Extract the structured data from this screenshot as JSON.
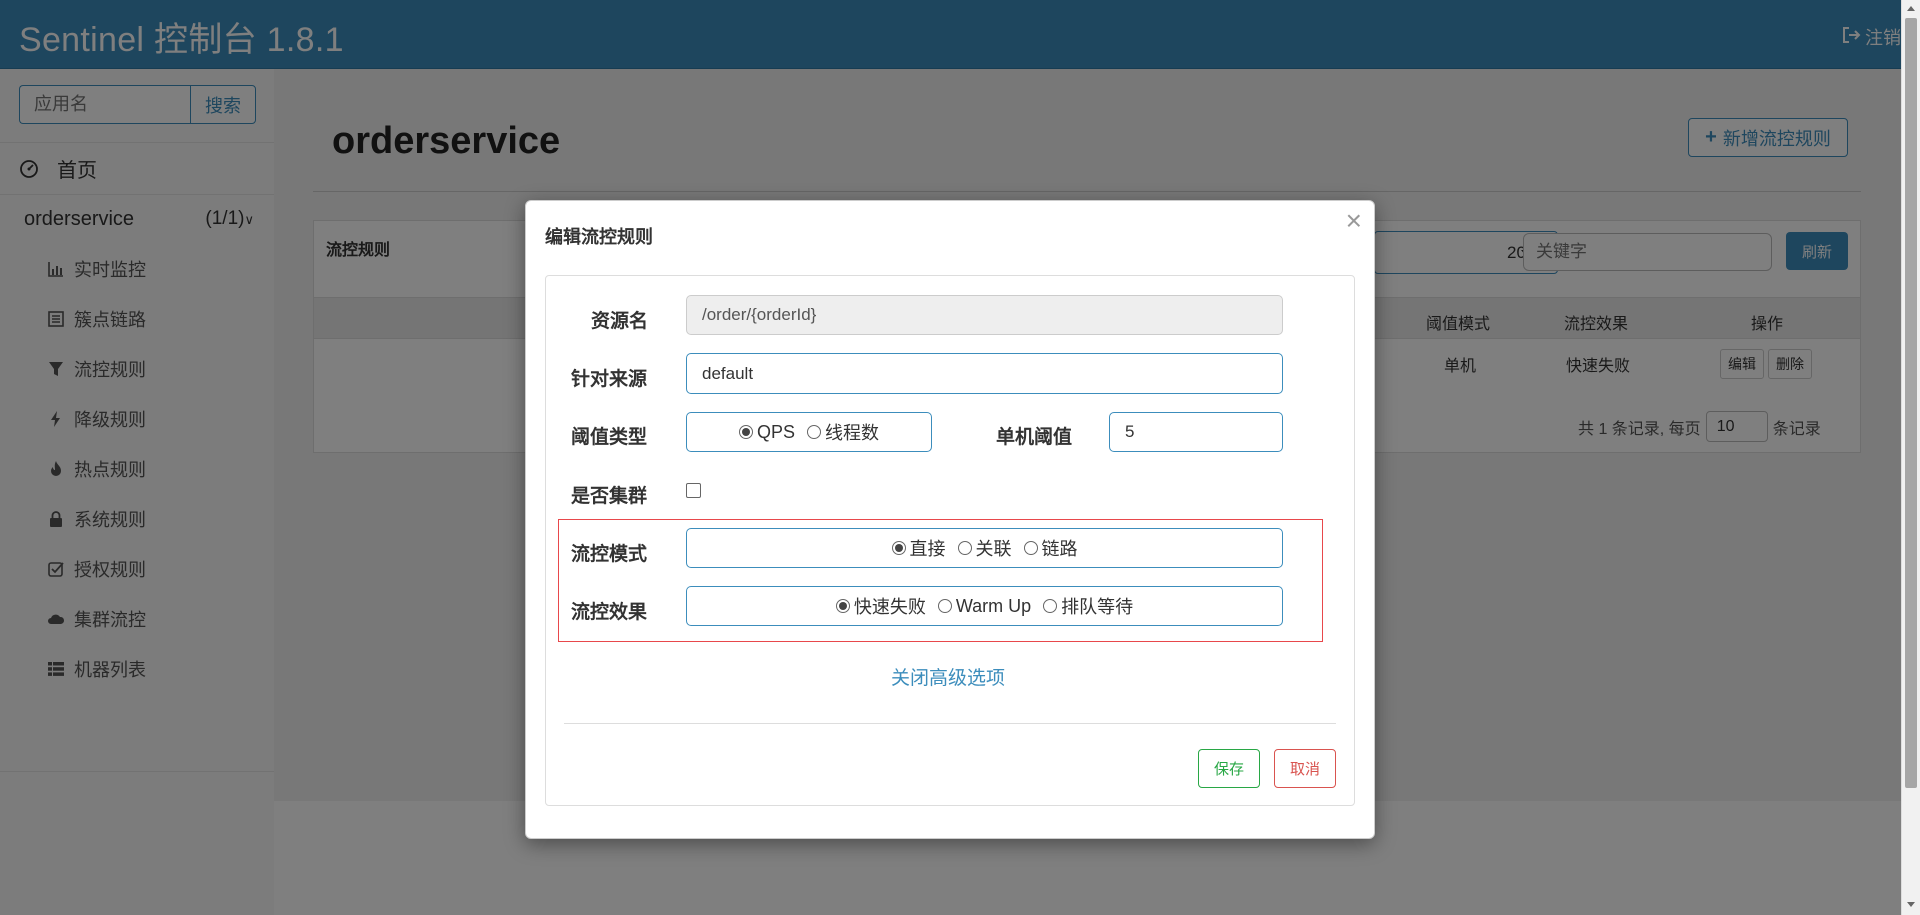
{
  "header": {
    "brand": "Sentinel 控制台 1.8.1",
    "logout_label": "注销"
  },
  "sidebar": {
    "search_placeholder": "应用名",
    "search_button": "搜索",
    "home": "首页",
    "app": {
      "name": "orderservice",
      "count": "(1/1)"
    },
    "items": [
      {
        "label": "实时监控",
        "icon": "bar-chart-icon"
      },
      {
        "label": "簇点链路",
        "icon": "list-alt-icon"
      },
      {
        "label": "流控规则",
        "icon": "filter-icon"
      },
      {
        "label": "降级规则",
        "icon": "flash-icon"
      },
      {
        "label": "热点规则",
        "icon": "fire-icon"
      },
      {
        "label": "系统规则",
        "icon": "lock-icon"
      },
      {
        "label": "授权规则",
        "icon": "check-icon"
      },
      {
        "label": "集群流控",
        "icon": "cloud-icon"
      },
      {
        "label": "机器列表",
        "icon": "th-list-icon"
      }
    ]
  },
  "main": {
    "title": "orderservice",
    "add_button": "新增流控规则",
    "panel_title": "流控规则",
    "page_size_value": "20",
    "keyword_placeholder": "关键字",
    "refresh_button": "刷新",
    "columns": {
      "threshold_mode": "阈值模式",
      "effect": "流控效果",
      "actions": "操作"
    },
    "row": {
      "threshold_mode": "单机",
      "effect": "快速失败",
      "edit": "编辑",
      "delete": "删除"
    },
    "pager": {
      "prefix": "共 1 条记录, 每页",
      "value": "10",
      "suffix": "条记录"
    }
  },
  "modal": {
    "title": "编辑流控规则",
    "close": "×",
    "resource_label": "资源名",
    "resource_value": "/order/{orderId}",
    "source_label": "针对来源",
    "source_value": "default",
    "threshold_type_label": "阈值类型",
    "threshold_type_options": [
      "QPS",
      "线程数"
    ],
    "threshold_type_selected": "QPS",
    "single_threshold_label": "单机阈值",
    "single_threshold_value": "5",
    "cluster_label": "是否集群",
    "cluster_checked": false,
    "mode_label": "流控模式",
    "mode_options": [
      "直接",
      "关联",
      "链路"
    ],
    "mode_selected": "直接",
    "effect_label": "流控效果",
    "effect_options": [
      "快速失败",
      "Warm Up",
      "排队等待"
    ],
    "effect_selected": "快速失败",
    "advanced_link": "关闭高级选项",
    "save_button": "保存",
    "cancel_button": "取消"
  },
  "colors": {
    "primary": "#3c8dbc",
    "success": "#28a745",
    "danger": "#d9534f",
    "highlight_border": "#e8474b"
  }
}
